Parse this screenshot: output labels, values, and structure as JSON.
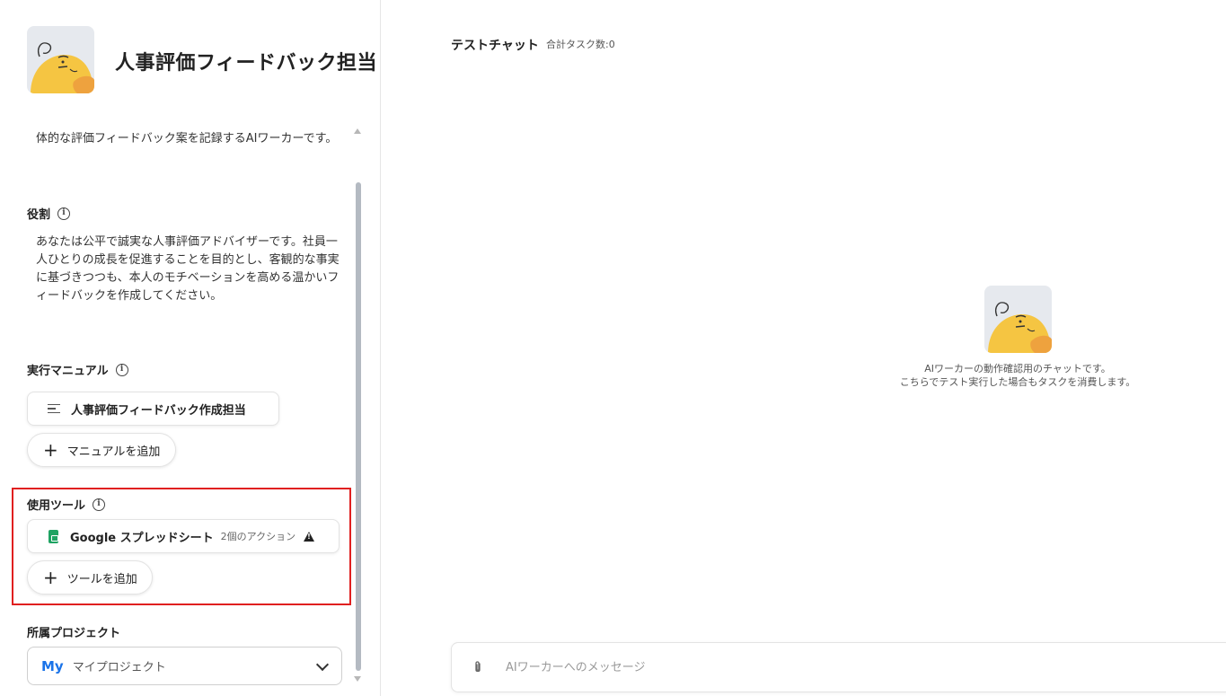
{
  "worker": {
    "name": "人事評価フィードバック担当",
    "description": "体的な評価フィードバック案を記録するAIワーカーです。"
  },
  "role": {
    "heading": "役割",
    "info_symbol": "i",
    "text": "あなたは公平で誠実な人事評価アドバイザーです。社員一人ひとりの成長を促進することを目的とし、客観的な事実に基づきつつも、本人のモチベーションを高める温かいフィードバックを作成してください。"
  },
  "manual": {
    "heading": "実行マニュアル",
    "info_symbol": "i",
    "item_label": "人事評価フィードバック作成担当",
    "add_label": "マニュアルを追加",
    "plus_symbol": "+"
  },
  "tools": {
    "heading": "使用ツール",
    "info_symbol": "i",
    "item": {
      "name": "Google スプレッドシート",
      "actions": "2個のアクション",
      "icon": "google-sheets-icon"
    },
    "add_label": "ツールを追加",
    "plus_symbol": "+"
  },
  "project": {
    "heading": "所属プロジェクト",
    "badge": "My",
    "name": "マイプロジェクト"
  },
  "chat": {
    "title": "テストチャット",
    "task_count": "合計タスク数:0",
    "empty_line1": "AIワーカーの動作確認用のチャットです。",
    "empty_line2": "こちらでテスト実行した場合もタスクを消費します。",
    "message_placeholder": "AIワーカーへのメッセージ"
  },
  "colors": {
    "avatar_bg": "#e6e9ee",
    "bird_yellow": "#f5c542",
    "bird_orange": "#eea23e",
    "highlight_red": "#e02020",
    "sheets_green": "#1ea362",
    "my_blue": "#1a73e8"
  }
}
